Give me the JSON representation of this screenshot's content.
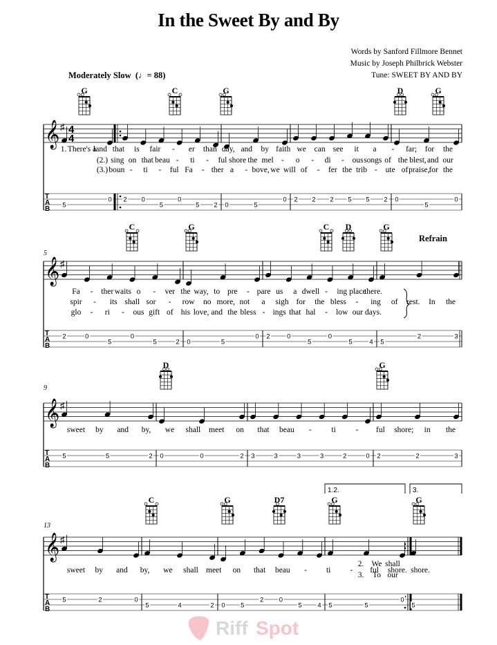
{
  "title": "In the Sweet By and By",
  "credits": {
    "words": "Words by Sanford Fillmore Bennet",
    "music": "Music by Joseph Philbrick Webster",
    "tune": "Tune: SWEET BY AND BY"
  },
  "tempo": {
    "marking": "Moderately Slow",
    "bpm_text": "= 88"
  },
  "key_signature": "G major (1 sharp)",
  "time_signature": {
    "top": "4",
    "bottom": "4"
  },
  "refrain_label": "Refrain",
  "watermark": "RiffSpot",
  "systems": [
    {
      "measure_number": "",
      "chords": [
        {
          "name": "G"
        },
        {
          "name": "C"
        },
        {
          "name": "G"
        },
        {
          "name": "D"
        },
        {
          "name": "G"
        }
      ],
      "lyrics": {
        "verse1": [
          "1.",
          "There's a",
          "land",
          "that",
          "is",
          "fair",
          "-",
          "er",
          "than",
          "day,",
          "and",
          "by",
          "faith",
          "we",
          "can",
          "see",
          "it",
          "a",
          "-",
          "far;",
          "for",
          "the"
        ],
        "verse2": [
          "(2.)",
          "sing",
          "on",
          "that",
          "beau",
          "-",
          "ti",
          "-",
          "ful",
          "shore",
          "the",
          "mel",
          "-",
          "o",
          "-",
          "di",
          "-",
          "ous",
          "songs",
          "of",
          "the",
          "blest,",
          "and",
          "our"
        ],
        "verse3": [
          "(3.)",
          "boun",
          "-",
          "ti",
          "-",
          "ful",
          "Fa",
          "-",
          "ther",
          "a",
          "-",
          "bove,",
          "we",
          "will",
          "of",
          "-",
          "fer",
          "the",
          "trib",
          "-",
          "ute",
          "of",
          "praise,",
          "for",
          "the"
        ]
      },
      "tab": [
        [
          {
            "s": 2,
            "f": "5"
          },
          {
            "s": 1,
            "f": "0"
          }
        ],
        [
          {
            "s": 1,
            "f": "2"
          },
          {
            "s": 1,
            "f": "0"
          },
          {
            "s": 2,
            "f": "5"
          },
          {
            "s": 1,
            "f": "0"
          },
          {
            "s": 2,
            "f": "5"
          },
          {
            "s": 2,
            "f": "2"
          }
        ],
        [
          {
            "s": 2,
            "f": "0"
          },
          {
            "s": 2,
            "f": "5"
          },
          {
            "s": 1,
            "f": "0"
          }
        ],
        [
          {
            "s": 1,
            "f": "2"
          },
          {
            "s": 1,
            "f": "2"
          },
          {
            "s": 1,
            "f": "2"
          },
          {
            "s": 1,
            "f": "5"
          },
          {
            "s": 1,
            "f": "5"
          },
          {
            "s": 1,
            "f": "2"
          }
        ],
        [
          {
            "s": 1,
            "f": "0"
          },
          {
            "s": 2,
            "f": "5"
          },
          {
            "s": 1,
            "f": "0"
          }
        ]
      ]
    },
    {
      "measure_number": "5",
      "chords": [
        {
          "name": "C"
        },
        {
          "name": "G"
        },
        {
          "name": "C"
        },
        {
          "name": "D"
        },
        {
          "name": "G"
        }
      ],
      "lyrics": {
        "verse1": [
          "Fa",
          "-",
          "ther",
          "waits",
          "o",
          "-",
          "ver",
          "the",
          "way,",
          "to",
          "pre",
          "-",
          "pare",
          "us",
          "a",
          "dwell",
          "-",
          "ing",
          "place",
          "there."
        ],
        "verse2": [
          "spir",
          "-",
          "its",
          "shall",
          "sor",
          "-",
          "row",
          "no",
          "more,",
          "not",
          "a",
          "sigh",
          "for",
          "the",
          "bless",
          "-",
          "ing",
          "of",
          "rest.",
          "In",
          "the"
        ],
        "verse3": [
          "glo",
          "-",
          "ri",
          "-",
          "ous",
          "gift",
          "of",
          "his",
          "love,",
          "and",
          "the",
          "bless",
          "-",
          "ings",
          "that",
          "hal",
          "-",
          "low",
          "our",
          "days."
        ]
      },
      "tab": [
        [
          {
            "s": 1,
            "f": "2"
          },
          {
            "s": 1,
            "f": "0"
          },
          {
            "s": 2,
            "f": "5"
          },
          {
            "s": 1,
            "f": "0"
          },
          {
            "s": 2,
            "f": "5"
          },
          {
            "s": 2,
            "f": "2"
          }
        ],
        [
          {
            "s": 2,
            "f": "0"
          },
          {
            "s": 2,
            "f": "5"
          },
          {
            "s": 1,
            "f": "0"
          }
        ],
        [
          {
            "s": 1,
            "f": "2"
          },
          {
            "s": 1,
            "f": "0"
          },
          {
            "s": 2,
            "f": "5"
          },
          {
            "s": 1,
            "f": "0"
          },
          {
            "s": 2,
            "f": "5"
          },
          {
            "s": 2,
            "f": "4"
          }
        ],
        [
          {
            "s": 2,
            "f": "5"
          },
          {
            "s": 1,
            "f": "2"
          },
          {
            "s": 1,
            "f": "3"
          }
        ]
      ]
    },
    {
      "measure_number": "9",
      "chords": [
        {
          "name": "D"
        },
        {
          "name": "G"
        }
      ],
      "lyrics": {
        "verse1": [
          "sweet",
          "by",
          "and",
          "by,",
          "we",
          "shall",
          "meet",
          "on",
          "that",
          "beau",
          "-",
          "ti",
          "-",
          "ful",
          "shore;",
          "in",
          "the"
        ]
      },
      "tab": [
        [
          {
            "s": 1,
            "f": "5"
          },
          {
            "s": 1,
            "f": "5"
          },
          {
            "s": 1,
            "f": "2"
          }
        ],
        [
          {
            "s": 1,
            "f": "0"
          },
          {
            "s": 1,
            "f": "0"
          },
          {
            "s": 1,
            "f": "2"
          }
        ],
        [
          {
            "s": 1,
            "f": "3"
          },
          {
            "s": 1,
            "f": "3"
          },
          {
            "s": 1,
            "f": "3"
          },
          {
            "s": 1,
            "f": "3"
          },
          {
            "s": 1,
            "f": "2"
          },
          {
            "s": 1,
            "f": "0"
          }
        ],
        [
          {
            "s": 1,
            "f": "2"
          },
          {
            "s": 1,
            "f": "2"
          },
          {
            "s": 1,
            "f": "3"
          }
        ]
      ]
    },
    {
      "measure_number": "13",
      "chords": [
        {
          "name": "C"
        },
        {
          "name": "G"
        },
        {
          "name": "D7"
        },
        {
          "name": "G"
        },
        {
          "name": "G"
        }
      ],
      "endings": [
        "1.2.",
        "3."
      ],
      "lyrics": {
        "verse1": [
          "sweet",
          "by",
          "and",
          "by,",
          "we",
          "shall",
          "meet",
          "on",
          "that",
          "beau",
          "-",
          "ti",
          "-",
          "ful",
          "shore.",
          "shore."
        ],
        "verse2_pickup": [
          "2.",
          "We",
          "shall"
        ],
        "verse3_pickup": [
          "3.",
          "To",
          "our"
        ]
      },
      "tab": [
        [
          {
            "s": 1,
            "f": "5"
          },
          {
            "s": 1,
            "f": "2"
          },
          {
            "s": 1,
            "f": "0"
          }
        ],
        [
          {
            "s": 2,
            "f": "5"
          },
          {
            "s": 2,
            "f": "4"
          },
          {
            "s": 2,
            "f": "2"
          }
        ],
        [
          {
            "s": 2,
            "f": "0"
          },
          {
            "s": 2,
            "f": "5"
          },
          {
            "s": 1,
            "f": "2"
          },
          {
            "s": 1,
            "f": "0"
          },
          {
            "s": 2,
            "f": "5"
          },
          {
            "s": 2,
            "f": "4"
          }
        ],
        [
          {
            "s": 2,
            "f": "5"
          },
          {
            "s": 2,
            "f": "5"
          },
          {
            "s": 1,
            "f": "0"
          }
        ],
        [
          {
            "s": 2,
            "f": "5"
          }
        ]
      ]
    }
  ]
}
